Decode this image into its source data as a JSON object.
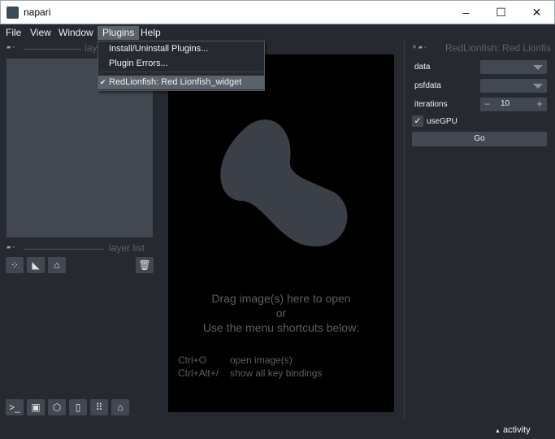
{
  "window": {
    "title": "napari",
    "minimize": "–",
    "maximize": "☐",
    "close": "✕"
  },
  "menubar": [
    "File",
    "View",
    "Window",
    "Plugins",
    "Help"
  ],
  "plugins_menu": {
    "items": [
      "Install/Uninstall Plugins...",
      "Plugin Errors..."
    ],
    "checked_item": "RedLionfish: Red Lionfish_widget",
    "check": "✔"
  },
  "layer_controls": {
    "title": "layer controls"
  },
  "layer_list": {
    "title": "layer list"
  },
  "welcome": {
    "line1": "Drag image(s) here to open",
    "line2": "or",
    "line3": "Use the menu shortcuts below:",
    "shortcuts": [
      {
        "key": "Ctrl+O",
        "action": "open image(s)"
      },
      {
        "key": "Ctrl+Alt+/",
        "action": "show all key bindings"
      }
    ]
  },
  "widget": {
    "title": "RedLionfish: Red Lionfish_widget",
    "data_label": "data",
    "psf_label": "psfdata",
    "iterations_label": "iterations",
    "iterations_value": "10",
    "minus": "−",
    "plus": "+",
    "usegpu_label": "useGPU",
    "usegpu_checked": true,
    "go_label": "Go"
  },
  "status": {
    "activity": "activity",
    "arrow": "▲"
  }
}
